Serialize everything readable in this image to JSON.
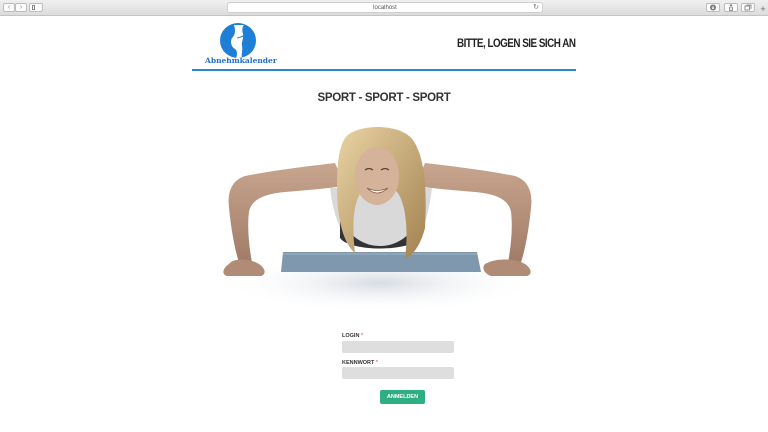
{
  "browser": {
    "url": "localhost",
    "back_glyph": "‹",
    "forward_glyph": "›",
    "reload_glyph": "↻",
    "new_tab_glyph": "+"
  },
  "header": {
    "logo_text": "Abnehmkalender",
    "title": "BITTE, LOGEN SIE SICH AN",
    "accent_color": "#2a85d6"
  },
  "main": {
    "title": "SPORT - SPORT - SPORT"
  },
  "form": {
    "login_label": "LOGIN",
    "login_required": "*",
    "login_value": "",
    "password_label": "KENNWORT",
    "password_required": "*",
    "password_value": "",
    "submit_label": "ANMELDEN",
    "submit_color": "#2fae84"
  }
}
